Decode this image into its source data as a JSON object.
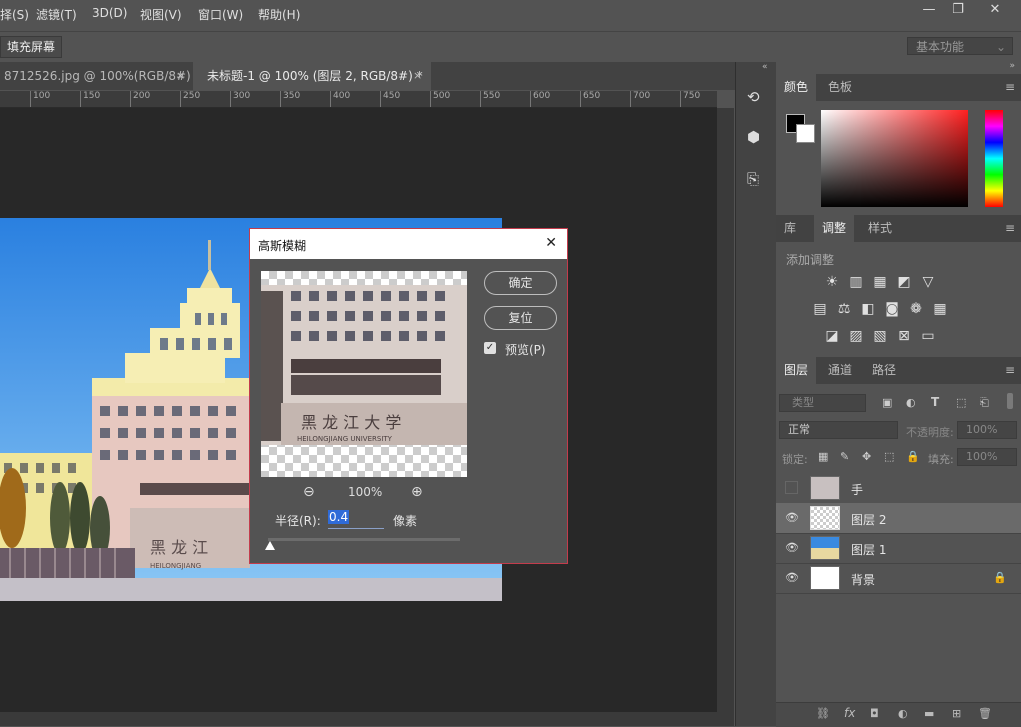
{
  "menu": [
    "择(S)",
    "滤镜(T)",
    "3D(D)",
    "视图(V)",
    "窗口(W)",
    "帮助(H)"
  ],
  "window_controls": {
    "minimize": "—",
    "restore": "❐",
    "close": "✕"
  },
  "options": {
    "fill_screen": "填充屏幕",
    "workspace": "基本功能"
  },
  "tabs": [
    {
      "label": "8712526.jpg @ 100%(RGB/8#)",
      "close": "×"
    },
    {
      "label": "未标题-1 @ 100% (图层 2, RGB/8#) *",
      "close": "×"
    }
  ],
  "ruler_ticks": [
    "100",
    "150",
    "200",
    "250",
    "300",
    "350",
    "400",
    "450",
    "500",
    "550",
    "600",
    "650",
    "700",
    "750"
  ],
  "dialog": {
    "title": "高斯模糊",
    "close": "✕",
    "ok": "确定",
    "reset": "复位",
    "preview_label": "预览(P)",
    "zoom": "100%",
    "radius_label": "半径(R):",
    "radius_value": "0.4",
    "unit": "像素",
    "preview_text_line1": "黑 龙 江 大 学",
    "preview_text_line2": "HEILONGJIANG UNIVERSITY"
  },
  "photo": {
    "sign_text": "黑 龙 江",
    "sign_sub": "HEILONGJIANG"
  },
  "color_panel": {
    "tabs": [
      "颜色",
      "色板"
    ],
    "foreground": "#000000",
    "background": "#ffffff"
  },
  "adjust_panel": {
    "tabs": [
      "库",
      "调整",
      "样式"
    ],
    "title": "添加调整"
  },
  "layers_panel": {
    "tabs": [
      "图层",
      "通道",
      "路径"
    ],
    "filter": "类型",
    "blend_mode": "正常",
    "opacity_label": "不透明度:",
    "opacity_value": "100%",
    "lock_label": "锁定:",
    "fill_label": "填充:",
    "fill_value": "100%",
    "layers": [
      {
        "name": "手",
        "visible": false,
        "selected": false
      },
      {
        "name": "图层 2",
        "visible": true,
        "selected": true
      },
      {
        "name": "图层 1",
        "visible": true,
        "selected": false
      },
      {
        "name": "背景",
        "visible": true,
        "selected": false,
        "locked": true
      }
    ]
  }
}
